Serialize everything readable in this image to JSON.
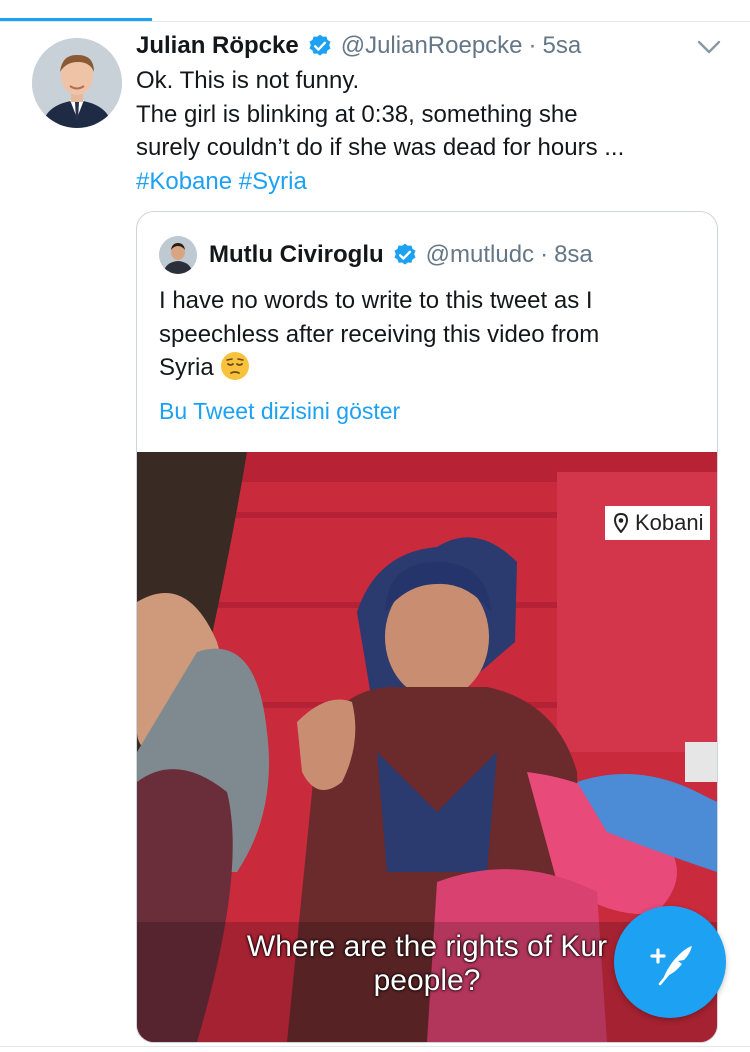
{
  "tweet": {
    "author_name": "Julian Röpcke",
    "author_handle": "@JulianRoepcke",
    "separator": "·",
    "time": "5sa",
    "lines": [
      "Ok. This is not funny.",
      "The girl is blinking at 0:38, something she",
      "surely couldn’t do if she was dead for hours ..."
    ],
    "hashtags": [
      "#Kobane",
      "#Syria"
    ]
  },
  "quoted_tweet": {
    "author_name": "Mutlu Civiroglu",
    "author_handle": "@mutludc",
    "separator": "·",
    "time": "8sa",
    "lines": [
      "I have no words to write to this tweet as I",
      "speechless after receiving this video from",
      "Syria"
    ],
    "emoji": "pensive-face-icon",
    "show_thread_label": "Bu Tweet dizisini göster",
    "video": {
      "location_label": "Kobani",
      "subtitle_line1": "Where are the rights of Kur",
      "subtitle_line2": "people?"
    }
  },
  "colors": {
    "accent": "#1da1f2",
    "text": "#14171a",
    "secondary": "#657786",
    "border": "#ccd6dd"
  },
  "icons": {
    "verified": "verified-badge-icon",
    "menu": "chevron-down-icon",
    "compose": "compose-tweet-icon",
    "location": "location-pin-icon"
  }
}
